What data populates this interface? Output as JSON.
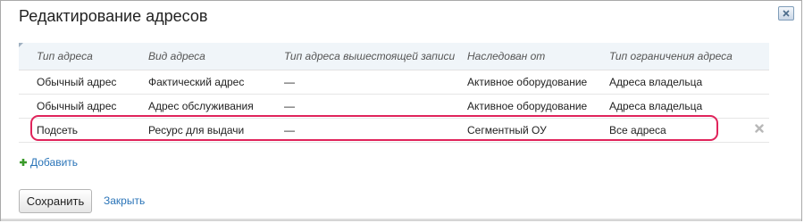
{
  "dialog": {
    "title": "Редактирование адресов",
    "close_icon": "close-icon"
  },
  "table": {
    "headers": [
      "Тип адреса",
      "Вид адреса",
      "Тип адреса вышестоящей записи",
      "Наследован от",
      "Тип ограничения адреса"
    ],
    "rows": [
      [
        "Обычный адрес",
        "Фактический адрес",
        "—",
        "Активное оборудование",
        "Адреса владельца"
      ],
      [
        "Обычный адрес",
        "Адрес обслуживания",
        "—",
        "Активное оборудование",
        "Адреса владельца"
      ],
      [
        "Подсеть",
        "Ресурс для выдачи",
        "—",
        "Сегментный ОУ",
        "Все адреса"
      ]
    ],
    "highlighted_row": 2,
    "highlight_color": "#e0245b"
  },
  "actions": {
    "add_label": "Добавить",
    "save_label": "Сохранить",
    "close_label": "Закрыть"
  },
  "colors": {
    "link": "#2a74b8",
    "add_icon": "#3a9a2a",
    "header_bg": "#f0f5f9"
  }
}
